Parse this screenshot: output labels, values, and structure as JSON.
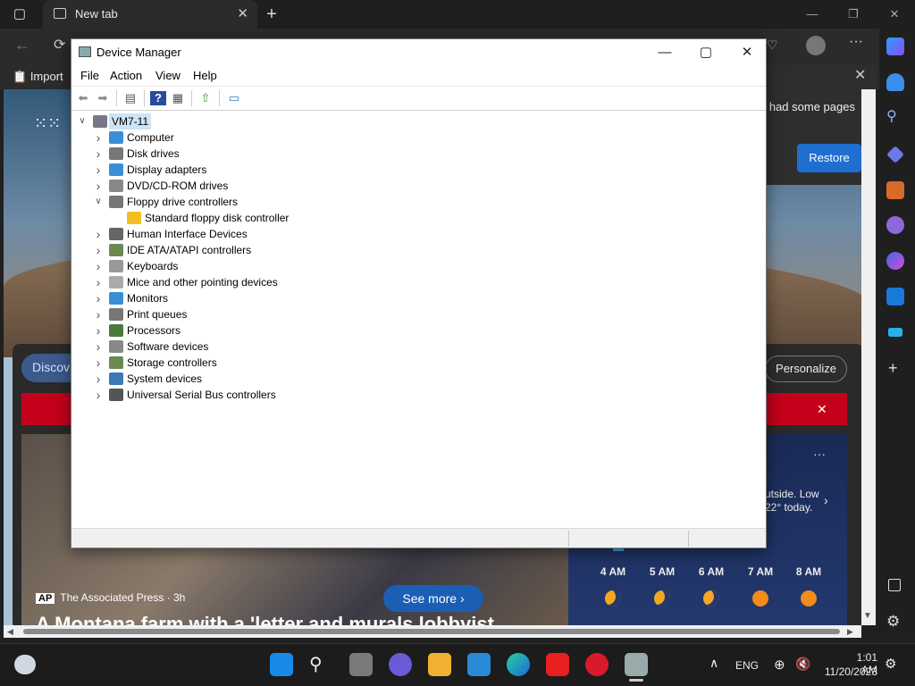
{
  "browser": {
    "tab_title": "New tab",
    "favorites_import": "Import",
    "restore_message": "u had some pages",
    "restore_button": "Restore"
  },
  "page": {
    "discover_label": "Discov",
    "personalize_label": "Personalize",
    "source": "The Associated Press · 3h",
    "see_more": "See more",
    "headline": "A Montana farm with a 'letter and murals lobbyist",
    "weather_text_line1": "utside. Low",
    "weather_text_line2": "22° today.",
    "hours": [
      {
        "time": "4 AM",
        "icon": "moon-icon"
      },
      {
        "time": "5 AM",
        "icon": "moon-icon"
      },
      {
        "time": "6 AM",
        "icon": "moon-icon"
      },
      {
        "time": "7 AM",
        "icon": "sun-icon"
      },
      {
        "time": "8 AM",
        "icon": "sun-icon"
      }
    ]
  },
  "device_manager": {
    "title": "Device Manager",
    "menu": [
      "File",
      "Action",
      "View",
      "Help"
    ],
    "root": "VM7-11",
    "categories": [
      {
        "label": "Computer",
        "expanded": false,
        "color": "#3a8ed8"
      },
      {
        "label": "Disk drives",
        "expanded": false,
        "color": "#777777"
      },
      {
        "label": "Display adapters",
        "expanded": false,
        "color": "#3a8ed8"
      },
      {
        "label": "DVD/CD-ROM drives",
        "expanded": false,
        "color": "#888888"
      },
      {
        "label": "Floppy drive controllers",
        "expanded": true,
        "color": "#777777"
      },
      {
        "label": "Standard floppy disk controller",
        "child": true,
        "warning": true,
        "color": "#f0c020"
      },
      {
        "label": "Human Interface Devices",
        "expanded": false,
        "color": "#666666"
      },
      {
        "label": "IDE ATA/ATAPI controllers",
        "expanded": false,
        "color": "#6a8a50"
      },
      {
        "label": "Keyboards",
        "expanded": false,
        "color": "#999999"
      },
      {
        "label": "Mice and other pointing devices",
        "expanded": false,
        "color": "#aaaaaa"
      },
      {
        "label": "Monitors",
        "expanded": false,
        "color": "#3a8ed8"
      },
      {
        "label": "Print queues",
        "expanded": false,
        "color": "#777777"
      },
      {
        "label": "Processors",
        "expanded": false,
        "color": "#4a7a3a"
      },
      {
        "label": "Software devices",
        "expanded": false,
        "color": "#888888"
      },
      {
        "label": "Storage controllers",
        "expanded": false,
        "color": "#6a8a50"
      },
      {
        "label": "System devices",
        "expanded": false,
        "color": "#3a7ab8"
      },
      {
        "label": "Universal Serial Bus controllers",
        "expanded": false,
        "color": "#555555"
      }
    ]
  },
  "taskbar": {
    "language": "ENG",
    "time": "1:01 AM",
    "date": "11/20/2023"
  }
}
